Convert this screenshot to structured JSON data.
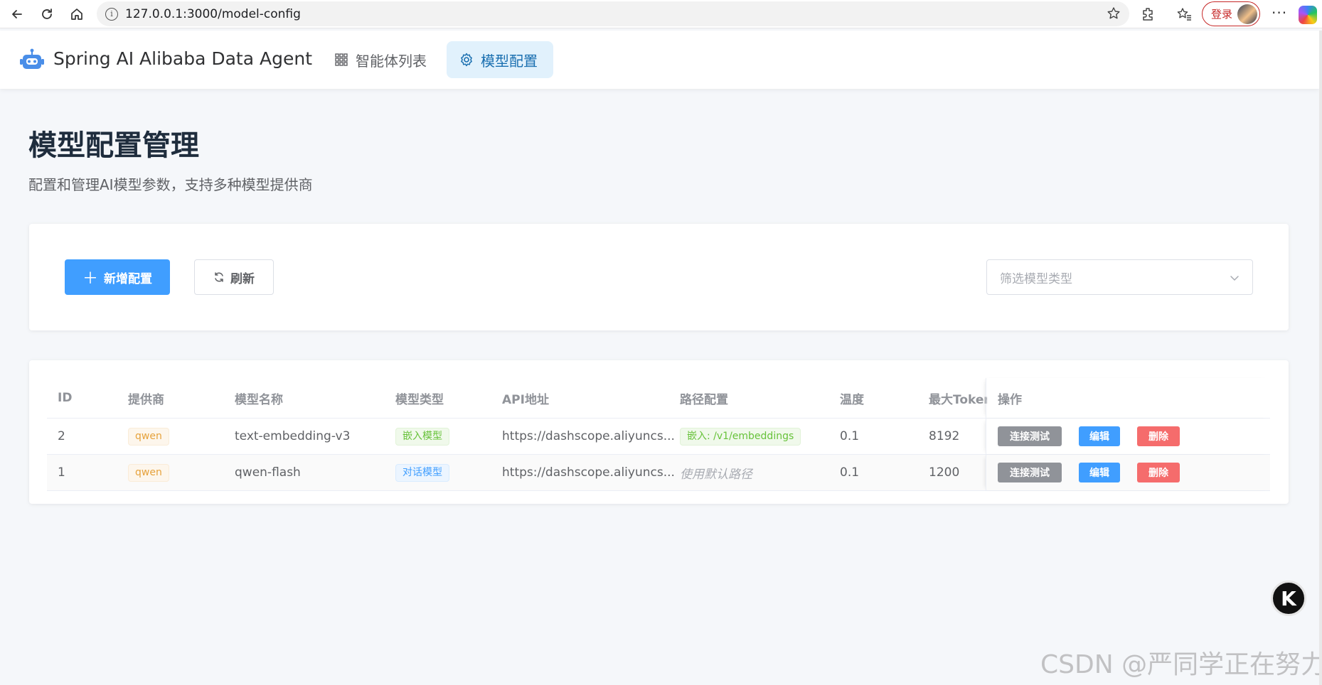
{
  "browser": {
    "url": "127.0.0.1:3000/model-config",
    "login_label": "登录",
    "more_label": "···"
  },
  "header": {
    "app_title": "Spring AI Alibaba Data Agent",
    "tabs": [
      {
        "label": "智能体列表",
        "icon": "grid-icon",
        "active": false
      },
      {
        "label": "模型配置",
        "icon": "gear-icon",
        "active": true
      }
    ]
  },
  "page": {
    "title": "模型配置管理",
    "subtitle": "配置和管理AI模型参数，支持多种模型提供商"
  },
  "toolbar": {
    "add_label": "新增配置",
    "refresh_label": "刷新",
    "filter_placeholder": "筛选模型类型"
  },
  "table": {
    "columns": [
      "ID",
      "提供商",
      "模型名称",
      "模型类型",
      "API地址",
      "路径配置",
      "温度",
      "最大Token",
      "操作"
    ],
    "rows": [
      {
        "id": "2",
        "provider": "qwen",
        "model_name": "text-embedding-v3",
        "model_type": "嵌入模型",
        "api": "https://dashscope.aliyuncs...",
        "path": "嵌入: /v1/embeddings",
        "temperature": "0.1",
        "max_tokens": "8192"
      },
      {
        "id": "1",
        "provider": "qwen",
        "model_name": "qwen-flash",
        "model_type": "对话模型",
        "api": "https://dashscope.aliyuncs...",
        "path": "使用默认路径",
        "temperature": "0.1",
        "max_tokens": "1200"
      }
    ],
    "actions": {
      "test": "连接测试",
      "edit": "编辑",
      "delete": "删除"
    }
  },
  "fab_label": "K",
  "watermark": "CSDN @严同学正在努力",
  "colors": {
    "primary": "#409eff",
    "danger": "#f56c6c",
    "info": "#909399",
    "active_tab_bg": "#e1f1fc"
  }
}
